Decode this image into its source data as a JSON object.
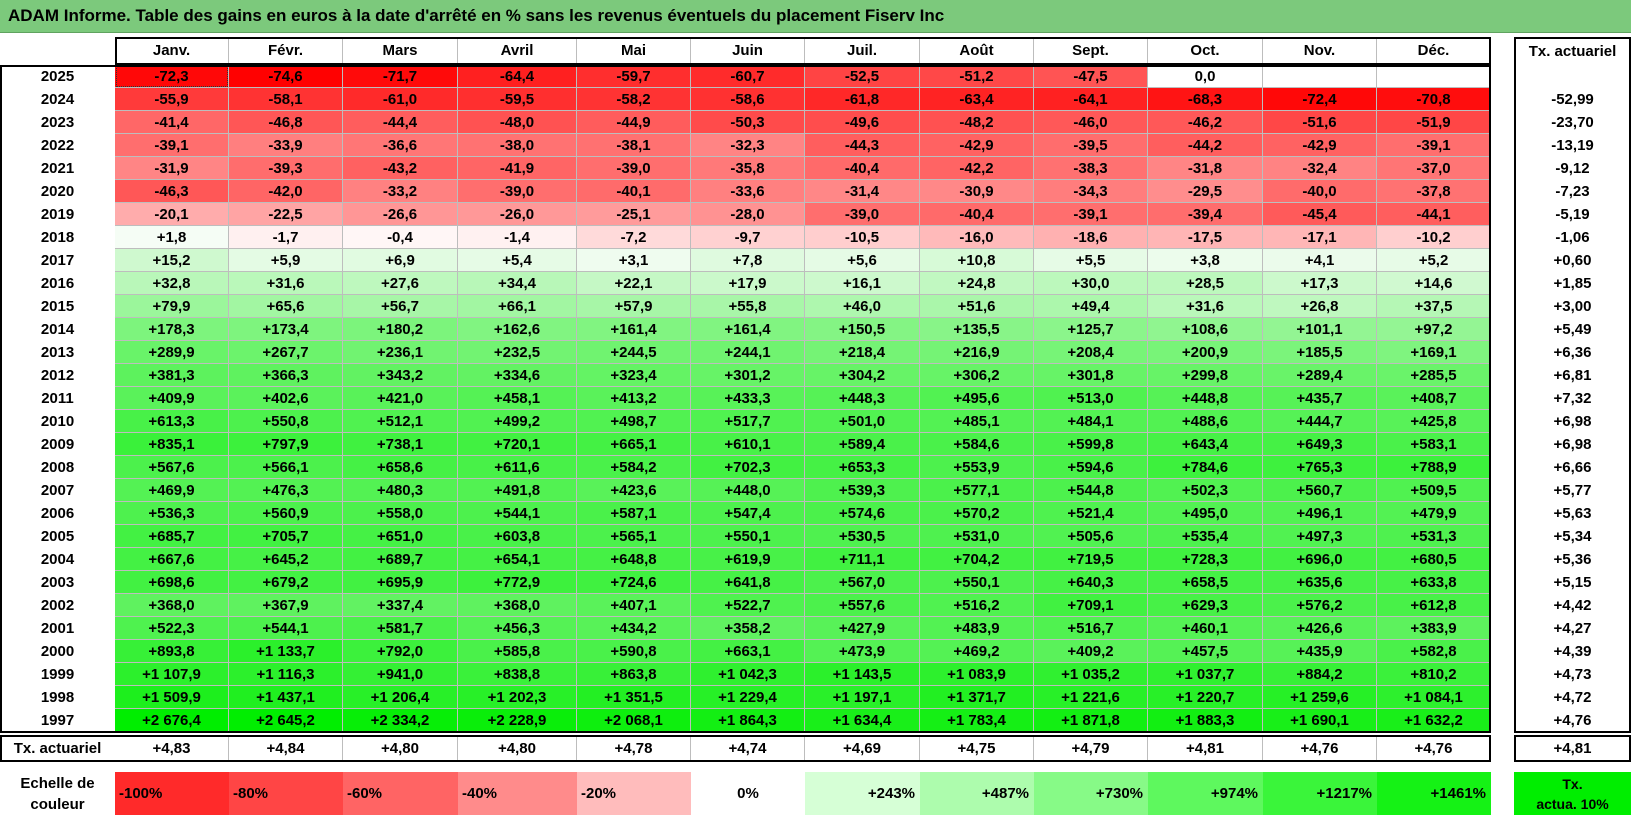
{
  "title": "ADAM Informe. Table des gains en euros à la date d'arrêté en % sans les revenus éventuels du placement Fiserv Inc",
  "months": [
    "Janv.",
    "Févr.",
    "Mars",
    "Avril",
    "Mai",
    "Juin",
    "Juil.",
    "Août",
    "Sept.",
    "Oct.",
    "Nov.",
    "Déc."
  ],
  "rate_header": "Tx. actuariel",
  "rows": [
    {
      "year": "2025",
      "values": [
        "-72,3",
        "-74,6",
        "-71,7",
        "-64,4",
        "-59,7",
        "-60,7",
        "-52,5",
        "-51,2",
        "-47,5",
        "0,0",
        "",
        ""
      ],
      "rate": ""
    },
    {
      "year": "2024",
      "values": [
        "-55,9",
        "-58,1",
        "-61,0",
        "-59,5",
        "-58,2",
        "-58,6",
        "-61,8",
        "-63,4",
        "-64,1",
        "-68,3",
        "-72,4",
        "-70,8"
      ],
      "rate": "-52,99"
    },
    {
      "year": "2023",
      "values": [
        "-41,4",
        "-46,8",
        "-44,4",
        "-48,0",
        "-44,9",
        "-50,3",
        "-49,6",
        "-48,2",
        "-46,0",
        "-46,2",
        "-51,6",
        "-51,9"
      ],
      "rate": "-23,70"
    },
    {
      "year": "2022",
      "values": [
        "-39,1",
        "-33,9",
        "-36,6",
        "-38,0",
        "-38,1",
        "-32,3",
        "-44,3",
        "-42,9",
        "-39,5",
        "-44,2",
        "-42,9",
        "-39,1"
      ],
      "rate": "-13,19"
    },
    {
      "year": "2021",
      "values": [
        "-31,9",
        "-39,3",
        "-43,2",
        "-41,9",
        "-39,0",
        "-35,8",
        "-40,4",
        "-42,2",
        "-38,3",
        "-31,8",
        "-32,4",
        "-37,0"
      ],
      "rate": "-9,12"
    },
    {
      "year": "2020",
      "values": [
        "-46,3",
        "-42,0",
        "-33,2",
        "-39,0",
        "-40,1",
        "-33,6",
        "-31,4",
        "-30,9",
        "-34,3",
        "-29,5",
        "-40,0",
        "-37,8"
      ],
      "rate": "-7,23"
    },
    {
      "year": "2019",
      "values": [
        "-20,1",
        "-22,5",
        "-26,6",
        "-26,0",
        "-25,1",
        "-28,0",
        "-39,0",
        "-40,4",
        "-39,1",
        "-39,4",
        "-45,4",
        "-44,1"
      ],
      "rate": "-5,19"
    },
    {
      "year": "2018",
      "values": [
        "+1,8",
        "-1,7",
        "-0,4",
        "-1,4",
        "-7,2",
        "-9,7",
        "-10,5",
        "-16,0",
        "-18,6",
        "-17,5",
        "-17,1",
        "-10,2"
      ],
      "rate": "-1,06"
    },
    {
      "year": "2017",
      "values": [
        "+15,2",
        "+5,9",
        "+6,9",
        "+5,4",
        "+3,1",
        "+7,8",
        "+5,6",
        "+10,8",
        "+5,5",
        "+3,8",
        "+4,1",
        "+5,2"
      ],
      "rate": "+0,60"
    },
    {
      "year": "2016",
      "values": [
        "+32,8",
        "+31,6",
        "+27,6",
        "+34,4",
        "+22,1",
        "+17,9",
        "+16,1",
        "+24,8",
        "+30,0",
        "+28,5",
        "+17,3",
        "+14,6"
      ],
      "rate": "+1,85"
    },
    {
      "year": "2015",
      "values": [
        "+79,9",
        "+65,6",
        "+56,7",
        "+66,1",
        "+57,9",
        "+55,8",
        "+46,0",
        "+51,6",
        "+49,4",
        "+31,6",
        "+26,8",
        "+37,5"
      ],
      "rate": "+3,00"
    },
    {
      "year": "2014",
      "values": [
        "+178,3",
        "+173,4",
        "+180,2",
        "+162,6",
        "+161,4",
        "+161,4",
        "+150,5",
        "+135,5",
        "+125,7",
        "+108,6",
        "+101,1",
        "+97,2"
      ],
      "rate": "+5,49"
    },
    {
      "year": "2013",
      "values": [
        "+289,9",
        "+267,7",
        "+236,1",
        "+232,5",
        "+244,5",
        "+244,1",
        "+218,4",
        "+216,9",
        "+208,4",
        "+200,9",
        "+185,5",
        "+169,1"
      ],
      "rate": "+6,36"
    },
    {
      "year": "2012",
      "values": [
        "+381,3",
        "+366,3",
        "+343,2",
        "+334,6",
        "+323,4",
        "+301,2",
        "+304,2",
        "+306,2",
        "+301,8",
        "+299,8",
        "+289,4",
        "+285,5"
      ],
      "rate": "+6,81"
    },
    {
      "year": "2011",
      "values": [
        "+409,9",
        "+402,6",
        "+421,0",
        "+458,1",
        "+413,2",
        "+433,3",
        "+448,3",
        "+495,6",
        "+513,0",
        "+448,8",
        "+435,7",
        "+408,7"
      ],
      "rate": "+7,32"
    },
    {
      "year": "2010",
      "values": [
        "+613,3",
        "+550,8",
        "+512,1",
        "+499,2",
        "+498,7",
        "+517,7",
        "+501,0",
        "+485,1",
        "+484,1",
        "+488,6",
        "+444,7",
        "+425,8"
      ],
      "rate": "+6,98"
    },
    {
      "year": "2009",
      "values": [
        "+835,1",
        "+797,9",
        "+738,1",
        "+720,1",
        "+665,1",
        "+610,1",
        "+589,4",
        "+584,6",
        "+599,8",
        "+643,4",
        "+649,3",
        "+583,1"
      ],
      "rate": "+6,98"
    },
    {
      "year": "2008",
      "values": [
        "+567,6",
        "+566,1",
        "+658,6",
        "+611,6",
        "+584,2",
        "+702,3",
        "+653,3",
        "+553,9",
        "+594,6",
        "+784,6",
        "+765,3",
        "+788,9"
      ],
      "rate": "+6,66"
    },
    {
      "year": "2007",
      "values": [
        "+469,9",
        "+476,3",
        "+480,3",
        "+491,8",
        "+423,6",
        "+448,0",
        "+539,3",
        "+577,1",
        "+544,8",
        "+502,3",
        "+560,7",
        "+509,5"
      ],
      "rate": "+5,77"
    },
    {
      "year": "2006",
      "values": [
        "+536,3",
        "+560,9",
        "+558,0",
        "+544,1",
        "+587,1",
        "+547,4",
        "+574,6",
        "+570,2",
        "+521,4",
        "+495,0",
        "+496,1",
        "+479,9"
      ],
      "rate": "+5,63"
    },
    {
      "year": "2005",
      "values": [
        "+685,7",
        "+705,7",
        "+651,0",
        "+603,8",
        "+565,1",
        "+550,1",
        "+530,5",
        "+531,0",
        "+505,6",
        "+535,4",
        "+497,3",
        "+531,3"
      ],
      "rate": "+5,34"
    },
    {
      "year": "2004",
      "values": [
        "+667,6",
        "+645,2",
        "+689,7",
        "+654,1",
        "+648,8",
        "+619,9",
        "+711,1",
        "+704,2",
        "+719,5",
        "+728,3",
        "+696,0",
        "+680,5"
      ],
      "rate": "+5,36"
    },
    {
      "year": "2003",
      "values": [
        "+698,6",
        "+679,2",
        "+695,9",
        "+772,9",
        "+724,6",
        "+641,8",
        "+567,0",
        "+550,1",
        "+640,3",
        "+658,5",
        "+635,6",
        "+633,8"
      ],
      "rate": "+5,15"
    },
    {
      "year": "2002",
      "values": [
        "+368,0",
        "+367,9",
        "+337,4",
        "+368,0",
        "+407,1",
        "+522,7",
        "+557,6",
        "+516,2",
        "+709,1",
        "+629,3",
        "+576,2",
        "+612,8"
      ],
      "rate": "+4,42"
    },
    {
      "year": "2001",
      "values": [
        "+522,3",
        "+544,1",
        "+581,7",
        "+456,3",
        "+434,2",
        "+358,2",
        "+427,9",
        "+483,9",
        "+516,7",
        "+460,1",
        "+426,6",
        "+383,9"
      ],
      "rate": "+4,27"
    },
    {
      "year": "2000",
      "values": [
        "+893,8",
        "+1 133,7",
        "+792,0",
        "+585,8",
        "+590,8",
        "+663,1",
        "+473,9",
        "+469,2",
        "+409,2",
        "+457,5",
        "+435,9",
        "+582,8"
      ],
      "rate": "+4,39"
    },
    {
      "year": "1999",
      "values": [
        "+1 107,9",
        "+1 116,3",
        "+941,0",
        "+838,8",
        "+863,8",
        "+1 042,3",
        "+1 143,5",
        "+1 083,9",
        "+1 035,2",
        "+1 037,7",
        "+884,2",
        "+810,2"
      ],
      "rate": "+4,73"
    },
    {
      "year": "1998",
      "values": [
        "+1 509,9",
        "+1 437,1",
        "+1 206,4",
        "+1 202,3",
        "+1 351,5",
        "+1 229,4",
        "+1 197,1",
        "+1 371,7",
        "+1 221,6",
        "+1 220,7",
        "+1 259,6",
        "+1 084,1"
      ],
      "rate": "+4,72"
    },
    {
      "year": "1997",
      "values": [
        "+2 676,4",
        "+2 645,2",
        "+2 334,2",
        "+2 228,9",
        "+2 068,1",
        "+1 864,3",
        "+1 634,4",
        "+1 783,4",
        "+1 871,8",
        "+1 883,3",
        "+1 690,1",
        "+1 632,2"
      ],
      "rate": "+4,76"
    }
  ],
  "summary": {
    "label": "Tx. actuariel",
    "values": [
      "+4,83",
      "+4,84",
      "+4,80",
      "+4,80",
      "+4,78",
      "+4,74",
      "+4,69",
      "+4,75",
      "+4,79",
      "+4,81",
      "+4,76",
      "+4,76"
    ],
    "overall": "+4,81"
  },
  "scale": {
    "label_line1": "Echelle de",
    "label_line2": "couleur",
    "items": [
      {
        "label": "-100%",
        "color": "#ff2a2a"
      },
      {
        "label": "-80%",
        "color": "#ff4545"
      },
      {
        "label": "-60%",
        "color": "#ff6464"
      },
      {
        "label": "-40%",
        "color": "#ff8b8b"
      },
      {
        "label": "-20%",
        "color": "#ffbcbc"
      },
      {
        "label": "0%",
        "color": "#ffffff"
      },
      {
        "label": "+243%",
        "color": "#d6ffd6"
      },
      {
        "label": "+487%",
        "color": "#adfcad"
      },
      {
        "label": "+730%",
        "color": "#87fa87"
      },
      {
        "label": "+974%",
        "color": "#5ef85e"
      },
      {
        "label": "+1217%",
        "color": "#3af53a"
      },
      {
        "label": "+1461%",
        "color": "#15f215"
      }
    ],
    "legend_line1": "Tx.",
    "legend_line2": "actua. 10%",
    "legend_color": "#00ee00"
  },
  "colors": {
    "title_bg": "#7cc97c",
    "negative_max": "#ff0000",
    "positive_max": "#00ee00"
  }
}
